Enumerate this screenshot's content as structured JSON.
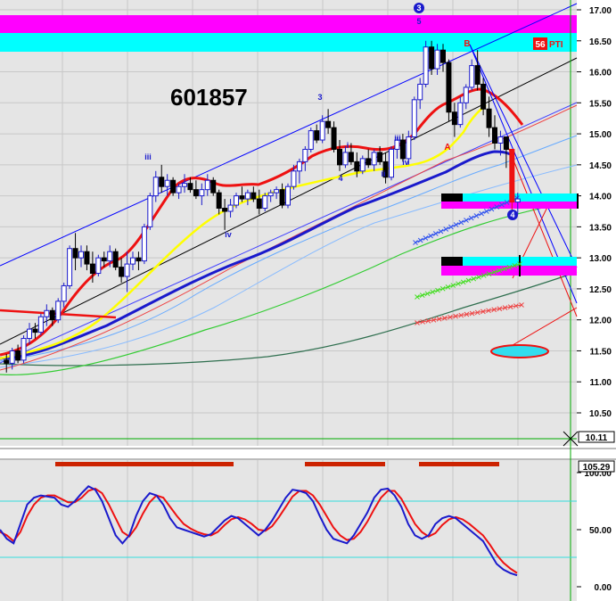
{
  "chart_data": {
    "type": "candlestick",
    "title": "601857",
    "price_axis": {
      "ticks": [
        "17.00",
        "16.50",
        "16.00",
        "15.50",
        "15.00",
        "14.50",
        "14.00",
        "13.50",
        "13.00",
        "12.50",
        "12.00",
        "11.50",
        "11.00",
        "10.50"
      ],
      "ylim": [
        10.15,
        17.1
      ],
      "last_price": "10.11"
    },
    "oscillator_axis": {
      "ticks": [
        "100.00",
        "50.00",
        "0.00"
      ],
      "ylim": [
        -5,
        110
      ],
      "current_value": "105.29"
    },
    "pti_badge": {
      "value": "56",
      "label": "PTI"
    },
    "wave_labels": [
      "3",
      "5",
      "3",
      "iii",
      "iv",
      "4",
      "i",
      "ii",
      "iii",
      "iv",
      "A",
      "B",
      "4",
      "iv"
    ],
    "candles": [
      [
        11.35,
        11.45,
        11.15,
        11.3
      ],
      [
        11.3,
        11.55,
        11.2,
        11.5
      ],
      [
        11.5,
        11.6,
        11.3,
        11.35
      ],
      [
        11.35,
        11.75,
        11.3,
        11.7
      ],
      [
        11.7,
        11.95,
        11.6,
        11.85
      ],
      [
        11.85,
        11.95,
        11.7,
        11.8
      ],
      [
        11.8,
        12.1,
        11.75,
        12.05
      ],
      [
        12.05,
        12.25,
        11.9,
        12.15
      ],
      [
        12.15,
        12.2,
        11.9,
        12.0
      ],
      [
        12.0,
        12.35,
        11.95,
        12.3
      ],
      [
        12.3,
        12.6,
        12.2,
        12.55
      ],
      [
        12.55,
        13.2,
        12.5,
        13.15
      ],
      [
        13.15,
        13.4,
        12.8,
        13.0
      ],
      [
        13.0,
        13.2,
        12.85,
        13.1
      ],
      [
        13.1,
        13.2,
        12.8,
        12.9
      ],
      [
        12.9,
        13.1,
        12.6,
        12.75
      ],
      [
        12.75,
        13.05,
        12.7,
        13.0
      ],
      [
        13.0,
        13.1,
        12.85,
        12.95
      ],
      [
        12.95,
        13.2,
        12.85,
        13.1
      ],
      [
        13.1,
        13.15,
        12.8,
        12.85
      ],
      [
        12.85,
        13.0,
        12.6,
        12.7
      ],
      [
        12.7,
        13.1,
        12.45,
        12.9
      ],
      [
        12.9,
        13.1,
        12.8,
        13.0
      ],
      [
        13.0,
        13.1,
        12.8,
        12.95
      ],
      [
        12.95,
        13.55,
        12.9,
        13.5
      ],
      [
        13.5,
        14.05,
        13.45,
        14.0
      ],
      [
        14.0,
        14.4,
        13.9,
        14.3
      ],
      [
        14.3,
        14.5,
        14.05,
        14.15
      ],
      [
        14.15,
        14.35,
        14.0,
        14.25
      ],
      [
        14.25,
        14.3,
        14.0,
        14.05
      ],
      [
        14.05,
        14.2,
        13.95,
        14.15
      ],
      [
        14.15,
        14.35,
        14.05,
        14.2
      ],
      [
        14.2,
        14.3,
        14.05,
        14.1
      ],
      [
        14.1,
        14.25,
        13.95,
        14.0
      ],
      [
        14.0,
        14.2,
        13.85,
        14.1
      ],
      [
        14.1,
        14.35,
        14.0,
        14.25
      ],
      [
        14.25,
        14.3,
        14.0,
        14.05
      ],
      [
        14.05,
        14.1,
        13.7,
        13.8
      ],
      [
        13.8,
        13.95,
        13.45,
        13.75
      ],
      [
        13.75,
        13.95,
        13.65,
        13.85
      ],
      [
        13.85,
        14.05,
        13.8,
        14.0
      ],
      [
        14.0,
        14.15,
        13.9,
        13.95
      ],
      [
        13.95,
        14.1,
        13.85,
        14.05
      ],
      [
        14.05,
        14.15,
        13.9,
        13.95
      ],
      [
        13.95,
        14.1,
        13.7,
        13.8
      ],
      [
        13.8,
        14.05,
        13.75,
        14.0
      ],
      [
        14.0,
        14.1,
        13.9,
        14.05
      ],
      [
        14.05,
        14.15,
        13.95,
        14.1
      ],
      [
        14.1,
        14.2,
        13.8,
        13.85
      ],
      [
        13.85,
        14.2,
        13.8,
        14.15
      ],
      [
        14.15,
        14.5,
        14.1,
        14.4
      ],
      [
        14.4,
        14.6,
        14.2,
        14.55
      ],
      [
        14.55,
        14.8,
        14.4,
        14.75
      ],
      [
        14.75,
        15.1,
        14.7,
        15.05
      ],
      [
        15.05,
        15.15,
        14.85,
        14.9
      ],
      [
        14.9,
        15.3,
        14.85,
        15.2
      ],
      [
        15.2,
        15.4,
        15.0,
        15.1
      ],
      [
        15.1,
        15.2,
        14.7,
        14.75
      ],
      [
        14.75,
        14.9,
        14.4,
        14.5
      ],
      [
        14.5,
        14.8,
        14.45,
        14.7
      ],
      [
        14.7,
        14.85,
        14.5,
        14.55
      ],
      [
        14.55,
        14.7,
        14.3,
        14.4
      ],
      [
        14.4,
        14.65,
        14.35,
        14.6
      ],
      [
        14.6,
        14.75,
        14.45,
        14.5
      ],
      [
        14.5,
        14.75,
        14.4,
        14.7
      ],
      [
        14.7,
        14.8,
        14.5,
        14.55
      ],
      [
        14.55,
        14.7,
        14.2,
        14.3
      ],
      [
        14.3,
        14.8,
        14.25,
        14.75
      ],
      [
        14.75,
        14.95,
        14.6,
        14.9
      ],
      [
        14.9,
        15.0,
        14.55,
        14.6
      ],
      [
        14.6,
        15.05,
        14.5,
        14.95
      ],
      [
        14.95,
        15.6,
        14.9,
        15.55
      ],
      [
        15.55,
        15.9,
        15.4,
        15.8
      ],
      [
        15.8,
        16.5,
        15.75,
        16.4
      ],
      [
        16.4,
        16.5,
        15.95,
        16.05
      ],
      [
        16.05,
        16.45,
        15.95,
        16.35
      ],
      [
        16.35,
        16.45,
        16.0,
        16.15
      ],
      [
        16.15,
        16.2,
        15.2,
        15.35
      ],
      [
        15.35,
        15.5,
        14.95,
        15.15
      ],
      [
        15.15,
        15.6,
        15.1,
        15.5
      ],
      [
        15.5,
        15.8,
        15.4,
        15.75
      ],
      [
        15.75,
        16.2,
        15.7,
        16.1
      ],
      [
        16.1,
        16.35,
        15.7,
        15.8
      ],
      [
        15.8,
        15.9,
        15.3,
        15.4
      ],
      [
        15.4,
        15.6,
        14.95,
        15.1
      ],
      [
        15.1,
        15.3,
        14.75,
        14.85
      ],
      [
        14.85,
        15.05,
        14.65,
        14.95
      ],
      [
        14.95,
        14.95,
        14.45,
        14.75
      ],
      [
        14.75,
        14.75,
        13.75,
        13.9
      ],
      [
        13.9,
        14.05,
        13.7,
        13.95
      ]
    ],
    "oscillator_k": [
      50,
      42,
      38,
      55,
      72,
      78,
      80,
      79,
      78,
      72,
      70,
      75,
      82,
      88,
      85,
      75,
      60,
      45,
      38,
      45,
      62,
      75,
      82,
      80,
      72,
      60,
      52,
      50,
      48,
      46,
      44,
      46,
      52,
      58,
      62,
      60,
      55,
      50,
      45,
      50,
      58,
      68,
      78,
      85,
      84,
      82,
      75,
      62,
      50,
      42,
      40,
      38,
      45,
      55,
      65,
      78,
      85,
      86,
      80,
      70,
      55,
      45,
      42,
      45,
      55,
      60,
      62,
      60,
      55,
      50,
      45,
      40,
      30,
      20,
      15,
      12,
      10
    ],
    "oscillator_d": [
      48,
      45,
      40,
      48,
      62,
      72,
      78,
      80,
      80,
      77,
      74,
      74,
      78,
      84,
      86,
      82,
      72,
      60,
      48,
      44,
      52,
      64,
      74,
      80,
      78,
      70,
      62,
      55,
      51,
      48,
      46,
      45,
      48,
      54,
      59,
      61,
      59,
      55,
      50,
      49,
      53,
      61,
      70,
      79,
      84,
      84,
      80,
      72,
      62,
      52,
      45,
      41,
      42,
      48,
      57,
      68,
      78,
      84,
      84,
      77,
      66,
      55,
      48,
      44,
      47,
      54,
      59,
      61,
      59,
      55,
      50,
      45,
      37,
      28,
      21,
      16,
      12
    ]
  }
}
